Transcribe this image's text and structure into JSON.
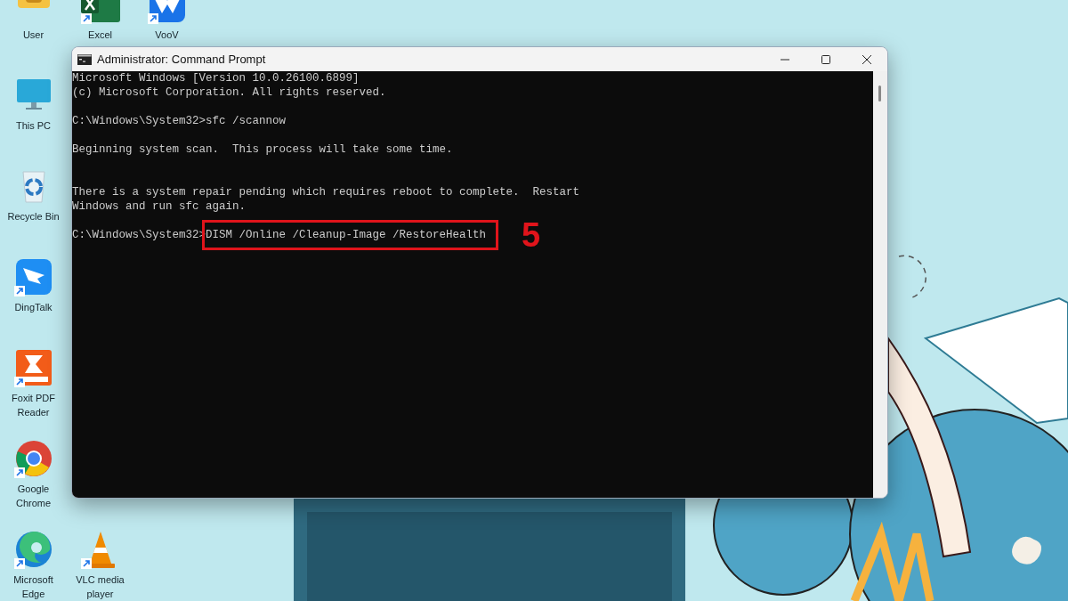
{
  "desktop": {
    "kind": "picture",
    "icon_rows": [
      [
        {
          "label": "User",
          "kind": "user",
          "shortcut": false
        },
        {
          "label": "Excel",
          "kind": "excel",
          "shortcut": true
        },
        {
          "label": "VooV",
          "kind": "voov",
          "shortcut": true
        }
      ],
      [
        {
          "label": "This PC",
          "kind": "pc",
          "shortcut": false
        }
      ],
      [
        {
          "label": "Recycle Bin",
          "kind": "recycle",
          "shortcut": false
        }
      ],
      [
        {
          "label": "DingTalk",
          "kind": "dingtalk",
          "shortcut": true
        }
      ],
      [
        {
          "label": "Foxit PDF Reader",
          "kind": "foxit",
          "shortcut": true
        }
      ],
      [
        {
          "label": "Google Chrome",
          "kind": "chrome",
          "shortcut": true
        }
      ],
      [
        {
          "label": "Microsoft Edge",
          "kind": "edge",
          "shortcut": true
        },
        {
          "label": "VLC media player",
          "kind": "vlc",
          "shortcut": true
        }
      ]
    ]
  },
  "window": {
    "title": "Administrator: Command Prompt",
    "console_lines": [
      {
        "kind": "output",
        "text": "Microsoft Windows [Version 10.0.26100.6899]"
      },
      {
        "kind": "output",
        "text": "(c) Microsoft Corporation. All rights reserved."
      },
      {
        "kind": "blank"
      },
      {
        "kind": "prompt",
        "prompt": "C:\\Windows\\System32>",
        "command": "sfc /scannow",
        "highlighted": false
      },
      {
        "kind": "blank"
      },
      {
        "kind": "output",
        "text": "Beginning system scan.  This process will take some time."
      },
      {
        "kind": "blank"
      },
      {
        "kind": "blank"
      },
      {
        "kind": "output",
        "text": "There is a system repair pending which requires reboot to complete.  Restart"
      },
      {
        "kind": "output",
        "text": "Windows and run sfc again."
      },
      {
        "kind": "blank"
      },
      {
        "kind": "prompt",
        "prompt": "C:\\Windows\\System32>",
        "command": "DISM /Online /Cleanup-Image /RestoreHealth",
        "highlighted": true,
        "step": "5"
      }
    ]
  }
}
